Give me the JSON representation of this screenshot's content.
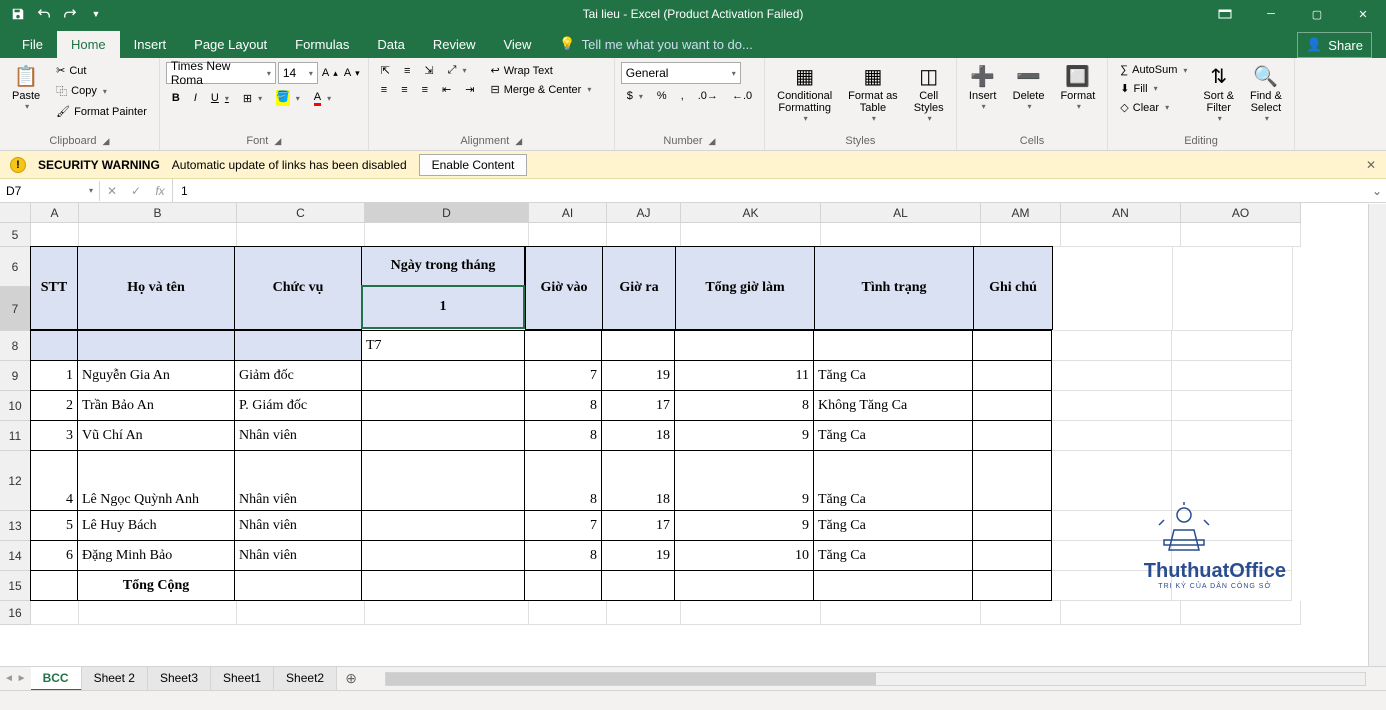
{
  "title": "Tai lieu - Excel (Product Activation Failed)",
  "tabs": {
    "file": "File",
    "list": [
      "Home",
      "Insert",
      "Page Layout",
      "Formulas",
      "Data",
      "Review",
      "View"
    ],
    "active": "Home",
    "tellme": "Tell me what you want to do...",
    "share": "Share"
  },
  "ribbon": {
    "clipboard": {
      "paste": "Paste",
      "cut": "Cut",
      "copy": "Copy",
      "fp": "Format Painter",
      "label": "Clipboard"
    },
    "font": {
      "name": "Times New Roma",
      "size": "14",
      "label": "Font"
    },
    "align": {
      "wrap": "Wrap Text",
      "merge": "Merge & Center",
      "label": "Alignment"
    },
    "number": {
      "format": "General",
      "label": "Number"
    },
    "styles": {
      "cond": "Conditional\nFormatting",
      "table": "Format as\nTable",
      "cell": "Cell\nStyles",
      "label": "Styles"
    },
    "cells": {
      "insert": "Insert",
      "delete": "Delete",
      "format": "Format",
      "label": "Cells"
    },
    "editing": {
      "sum": "AutoSum",
      "fill": "Fill",
      "clear": "Clear",
      "sort": "Sort &\nFilter",
      "find": "Find &\nSelect",
      "label": "Editing"
    }
  },
  "security": {
    "title": "SECURITY WARNING",
    "msg": "Automatic update of links has been disabled",
    "btn": "Enable Content"
  },
  "namebox": "D7",
  "formula": "1",
  "col_headers": [
    "A",
    "B",
    "C",
    "D",
    "AI",
    "AJ",
    "AK",
    "AL",
    "AM",
    "AN",
    "AO"
  ],
  "row_headers": [
    "5",
    "6",
    "7",
    "8",
    "9",
    "10",
    "11",
    "12",
    "13",
    "14",
    "15",
    "16"
  ],
  "table": {
    "h_stt": "STT",
    "h_name": "Họ và tên",
    "h_role": "Chức vụ",
    "h_day": "Ngày trong tháng",
    "h_day_val": "1",
    "h_in": "Giờ vào",
    "h_out": "Giờ ra",
    "h_total": "Tổng giờ làm",
    "h_status": "Tình trạng",
    "h_note": "Ghi chú",
    "t7": "T7",
    "rows": [
      {
        "stt": "1",
        "name": "Nguyễn Gia An",
        "role": "Giảm đốc",
        "in": "7",
        "out": "19",
        "total": "11",
        "status": "Tăng Ca"
      },
      {
        "stt": "2",
        "name": "Trần Bảo An",
        "role": "P. Giám đốc",
        "in": "8",
        "out": "17",
        "total": "8",
        "status": "Không Tăng Ca"
      },
      {
        "stt": "3",
        "name": "Vũ Chí An",
        "role": "Nhân viên",
        "in": "8",
        "out": "18",
        "total": "9",
        "status": "Tăng Ca"
      },
      {
        "stt": "4",
        "name": "Lê Ngọc Quỳnh Anh",
        "role": "Nhân viên",
        "in": "8",
        "out": "18",
        "total": "9",
        "status": "Tăng Ca"
      },
      {
        "stt": "5",
        "name": "Lê Huy Bách",
        "role": "Nhân viên",
        "in": "7",
        "out": "17",
        "total": "9",
        "status": "Tăng Ca"
      },
      {
        "stt": "6",
        "name": "Đặng Minh Bảo",
        "role": "Nhân viên",
        "in": "8",
        "out": "19",
        "total": "10",
        "status": "Tăng Ca"
      }
    ],
    "total_label": "Tổng Cộng"
  },
  "sheets": {
    "active": "BCC",
    "list": [
      "BCC",
      "Sheet 2",
      "Sheet3",
      "Sheet1",
      "Sheet2"
    ]
  },
  "watermark": {
    "main": "ThuthuatOffice",
    "sub": "TRI KỶ CỦA DÂN CÔNG SỞ"
  }
}
